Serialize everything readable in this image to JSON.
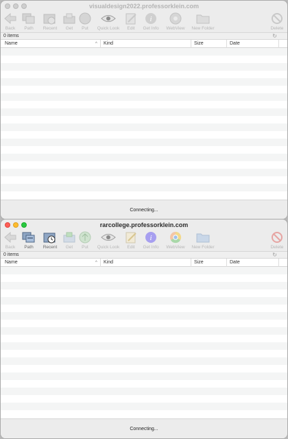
{
  "windows": [
    {
      "title": "visualdesign2022.professorklein.com",
      "active": false,
      "toolbar": [
        {
          "label": "Back",
          "icon": "back-arrow-icon"
        },
        {
          "label": "Path",
          "icon": "path-icon"
        },
        {
          "label": "Recent",
          "icon": "recent-icon"
        },
        {
          "label": "Get",
          "icon": "get-icon"
        },
        {
          "label": "Put",
          "icon": "put-icon"
        },
        {
          "label": "Quick Look",
          "icon": "eye-icon"
        },
        {
          "label": "Edit",
          "icon": "edit-icon"
        },
        {
          "label": "Get Info",
          "icon": "info-icon"
        },
        {
          "label": "WebView",
          "icon": "webview-icon"
        },
        {
          "label": "New Folder",
          "icon": "new-folder-icon"
        },
        {
          "label": "Delete",
          "icon": "delete-icon"
        }
      ],
      "item_count": "0 items",
      "columns": {
        "name": "Name",
        "kind": "Kind",
        "size": "Size",
        "date": "Date"
      },
      "sort_indicator": "^",
      "status": "Connecting..."
    },
    {
      "title": "rarcollege.professorklein.com",
      "active": true,
      "toolbar": [
        {
          "label": "Back",
          "icon": "back-arrow-icon"
        },
        {
          "label": "Path",
          "icon": "path-icon"
        },
        {
          "label": "Recent",
          "icon": "recent-icon"
        },
        {
          "label": "Get",
          "icon": "get-icon"
        },
        {
          "label": "Put",
          "icon": "put-icon"
        },
        {
          "label": "Quick Look",
          "icon": "eye-icon"
        },
        {
          "label": "Edit",
          "icon": "edit-icon"
        },
        {
          "label": "Get Info",
          "icon": "info-icon"
        },
        {
          "label": "WebView",
          "icon": "webview-icon"
        },
        {
          "label": "New Folder",
          "icon": "new-folder-icon"
        },
        {
          "label": "Delete",
          "icon": "delete-icon"
        }
      ],
      "item_count": "0 items",
      "columns": {
        "name": "Name",
        "kind": "Kind",
        "size": "Size",
        "date": "Date"
      },
      "sort_indicator": "^",
      "status": "Connecting..."
    }
  ],
  "colors": {
    "close": "#fe5f57",
    "minimize": "#febc2e",
    "zoom": "#28c840",
    "info": "#8a7fe0",
    "delete": "#d9534f"
  }
}
